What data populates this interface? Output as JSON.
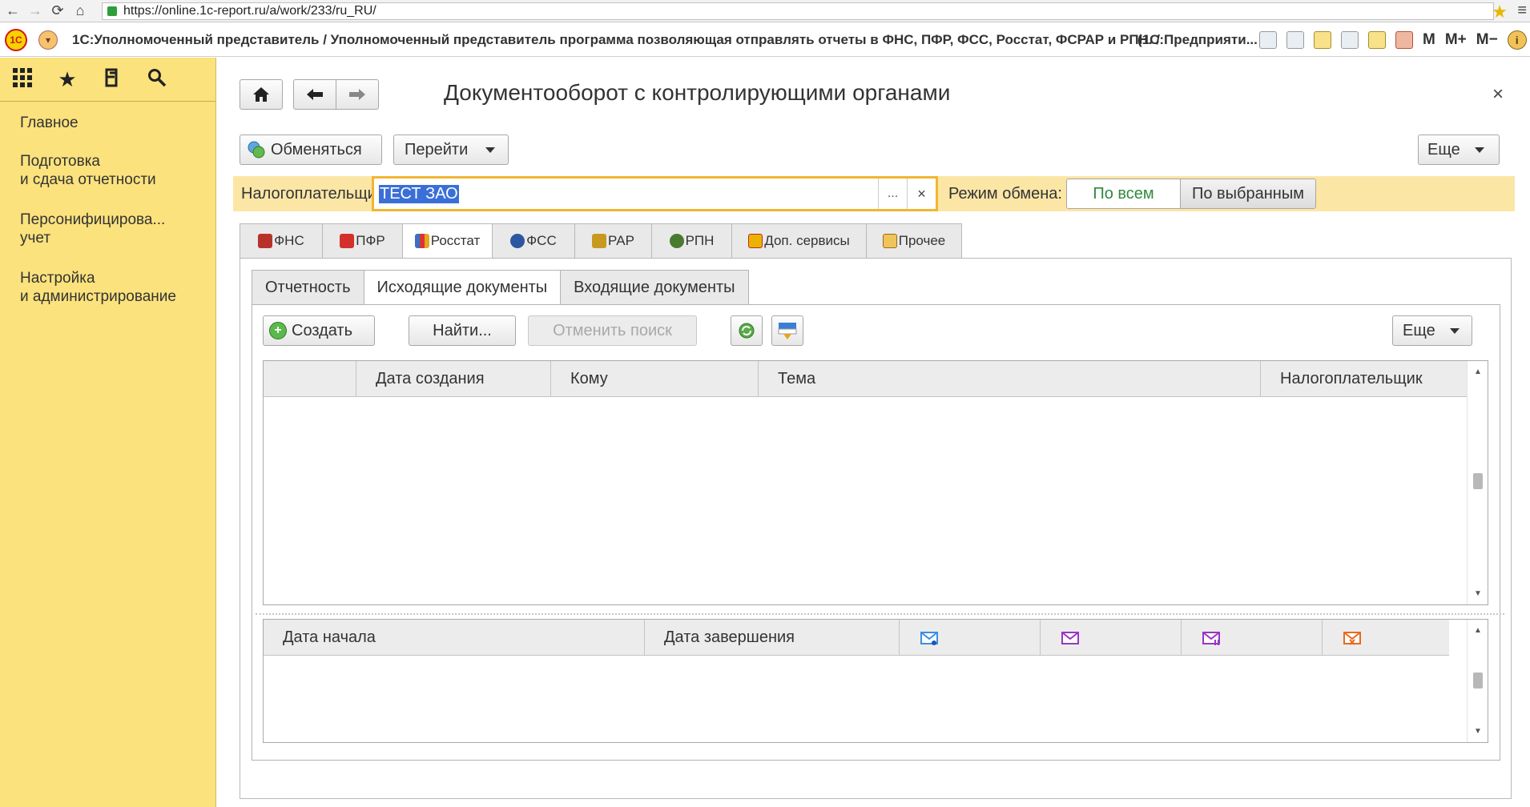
{
  "browser": {
    "url": "https://online.1c-report.ru/a/work/233/ru_RU/"
  },
  "app_header": {
    "title": "1С:Уполномоченный представитель / Уполномоченный представитель программа позволяющая отправлять отчеты в ФНС, ПФР, ФСС, Росстат, ФСРАР и РПН. /",
    "platform": "(1С:Предприяти...",
    "m_labels": [
      "M",
      "M+",
      "M−"
    ]
  },
  "sidebar": {
    "items": [
      {
        "label": "Главное"
      },
      {
        "label": "Подготовка\nи сдача отчетности"
      },
      {
        "label": "Персонифицирова...\nучет"
      },
      {
        "label": "Настройка\nи администрирование"
      }
    ]
  },
  "page": {
    "title": "Документооборот с контролирующими органами",
    "exchange_label": "Обменяться",
    "go_label": "Перейти",
    "more_label": "Еще"
  },
  "payer": {
    "label": "Налогоплательщик:",
    "value": "ТЕСТ ЗАО",
    "dots": "...",
    "clear": "×"
  },
  "mode": {
    "label": "Режим обмена:",
    "options": [
      "По всем",
      "По выбранным"
    ],
    "selected": "По выбранным"
  },
  "outer_tabs": [
    {
      "label": "ФНС",
      "icon": "fns-emblem-icon",
      "color": "#b8322c"
    },
    {
      "label": "ПФР",
      "icon": "pfr-logo-icon",
      "color": "#d3302c"
    },
    {
      "label": "Росстат",
      "icon": "rosstat-chart-icon",
      "color": "#3b6fc2",
      "active": true
    },
    {
      "label": "ФСС",
      "icon": "fss-emblem-icon",
      "color": "#2c56a0"
    },
    {
      "label": "РАР",
      "icon": "rar-eagle-icon",
      "color": "#c79a1f"
    },
    {
      "label": "РПН",
      "icon": "rpn-emblem-icon",
      "color": "#4a7a2e"
    },
    {
      "label": "Доп. сервисы",
      "icon": "1c-services-icon",
      "color": "#e8b400"
    },
    {
      "label": "Прочее",
      "icon": "mail-other-icon",
      "color": "#d69a1a"
    }
  ],
  "inner_tabs": [
    {
      "label": "Отчетность"
    },
    {
      "label": "Исходящие документы",
      "active": true
    },
    {
      "label": "Входящие документы"
    }
  ],
  "toolbar": {
    "create_label": "Создать",
    "find_label": "Найти...",
    "cancel_search_label": "Отменить поиск",
    "more_label": "Еще"
  },
  "docs_table": {
    "columns": [
      "",
      "Дата создания",
      "Кому",
      "Тема",
      "Налогоплательщик"
    ],
    "rows": []
  },
  "cycle_table": {
    "columns": [
      "Дата начала",
      "Дата завершения"
    ],
    "icon_columns": [
      {
        "icon": "envelope-sent-icon",
        "color": "#3a8ee6"
      },
      {
        "icon": "envelope-received-icon",
        "color": "#9a35c7"
      },
      {
        "icon": "envelope-processed-icon",
        "color": "#9a35c7"
      },
      {
        "icon": "envelope-error-icon",
        "color": "#e66b1f"
      }
    ],
    "rows": []
  }
}
